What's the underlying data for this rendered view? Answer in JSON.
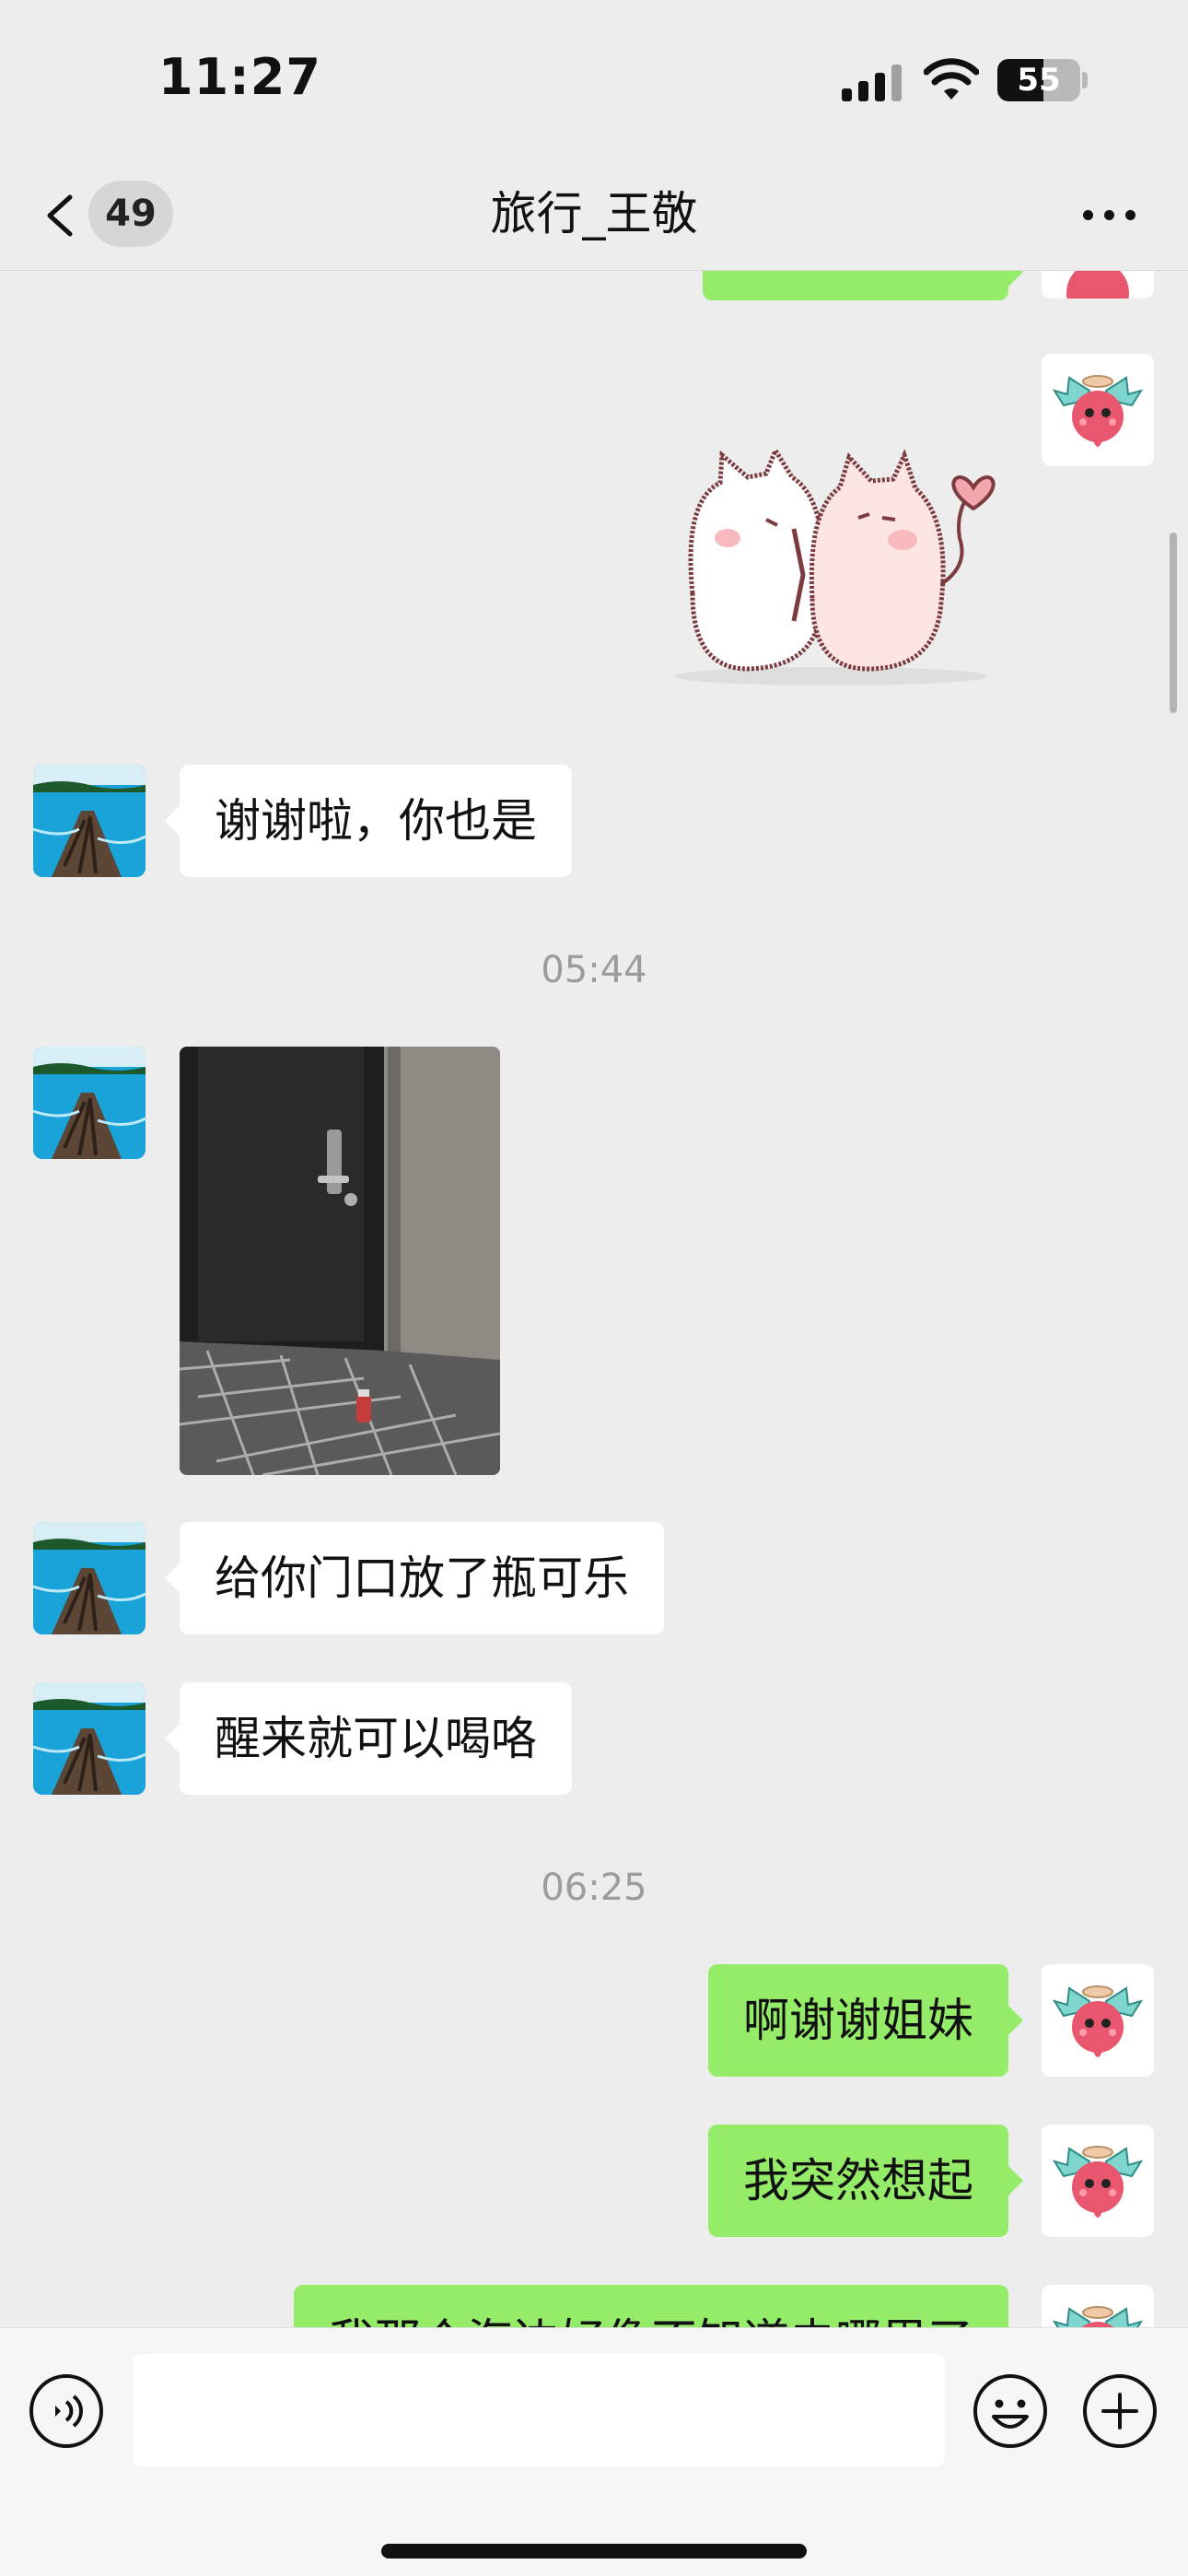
{
  "status_bar": {
    "time": "11:27",
    "battery_level": "55"
  },
  "nav": {
    "unread_count": "49",
    "title": "旅行_王敬"
  },
  "messages": {
    "m1_text": "谢谢啦，你也是",
    "time_1": "05:44",
    "m3_text": "给你门口放了瓶可乐",
    "m4_text": "醒来就可以喝咯",
    "time_2": "06:25",
    "m5_text": "啊谢谢姐妹",
    "m6_text": "我突然想起",
    "m7_text": "我那个海边好像不知道去哪里了"
  },
  "input": {
    "placeholder": ""
  },
  "colors": {
    "background": "#ededed",
    "outgoing_bubble": "#95ec69",
    "incoming_bubble": "#ffffff",
    "timestamp_text": "#9c9c9c"
  },
  "icons": [
    "back-chevron-icon",
    "more-icon",
    "signal-icon",
    "wifi-icon",
    "battery-icon",
    "voice-icon",
    "emoji-icon",
    "add-icon"
  ]
}
